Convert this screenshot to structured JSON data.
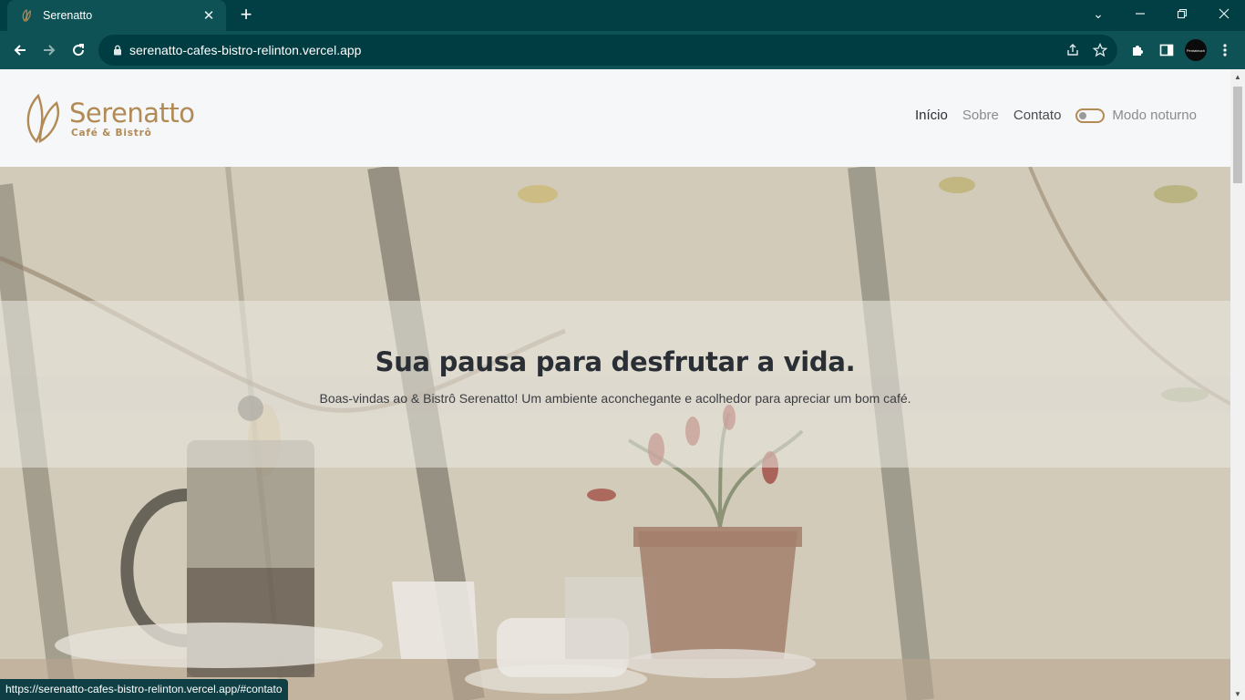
{
  "browser": {
    "tab_title": "Serenatto",
    "tab_close": "✕",
    "new_tab": "+",
    "url": "serenatto-cafes-bistro-relinton.vercel.app",
    "profile_label": "Pentateuch",
    "status_url": "https://serenatto-cafes-bistro-relinton.vercel.app/#contato",
    "window_controls": {
      "list": "⌄",
      "minimize": "—",
      "restore": "❐",
      "close": "✕"
    },
    "colors": {
      "frame": "#013f44",
      "toolbar": "#0f5256",
      "omnibox": "#003d42"
    }
  },
  "site": {
    "brand": "Serenatto",
    "brand_sub": "Café & Bistrô",
    "nav": {
      "home": "Início",
      "about": "Sobre",
      "contact": "Contato",
      "dark_mode": "Modo noturno"
    },
    "hero": {
      "title": "Sua pausa para desfrutar a vida.",
      "subtitle": "Boas-vindas ao & Bistrô Serenatto! Um ambiente aconchegante e acolhedor para apreciar um bom café."
    },
    "colors": {
      "accent": "#b18a55",
      "text": "#2a2e35"
    }
  }
}
